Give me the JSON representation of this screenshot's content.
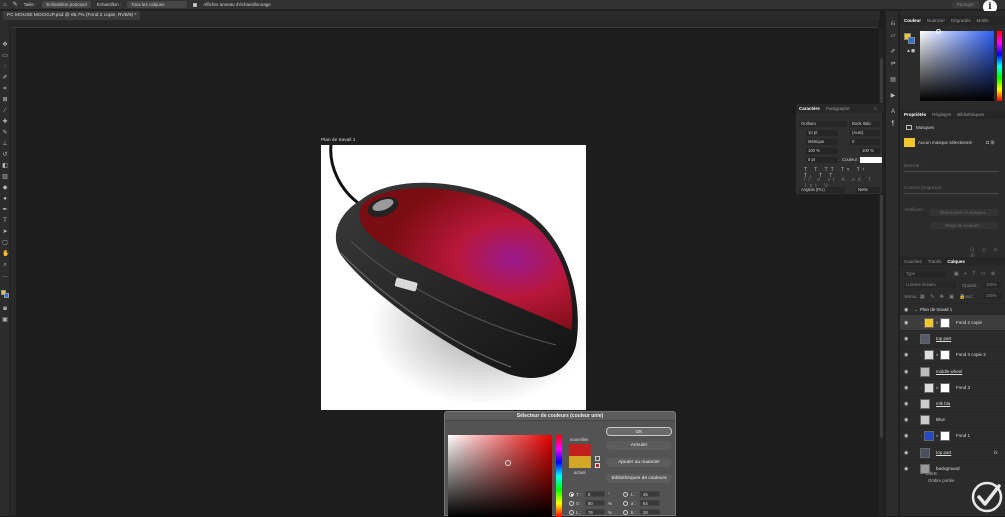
{
  "topbar": {
    "size_label": "Taille :",
    "size_value": "Echantillon ponctuel",
    "sample_label": "Echantillon :",
    "sample_value": "Tous les calques",
    "ring_label": "Afficher anneau d'échantillonnage",
    "share_label": "Partager"
  },
  "document": {
    "tab_title": "PC MOUSE MOCKUP.psd @ 66,7% (Fond 2 copie, RVB/8) *",
    "artboard_label": "Plan de travail 1"
  },
  "color_panel": {
    "tabs": [
      "Couleur",
      "Nuancier",
      "Dégradés",
      "Motifs"
    ],
    "fg_color": "#f2c72c",
    "bg_color": "#ffffff"
  },
  "properties_panel": {
    "tabs": [
      "Propriétés",
      "Réglages",
      "Bibliothèques"
    ],
    "section": "Masques",
    "no_mask": "Aucun masque sélectionné",
    "density_label": "Densité :",
    "feather_label": "Contour progressif :",
    "refine_label": "Améliorer :",
    "select_mask_btn": "Sélectionner et masquer...",
    "color_range_btn": "Plage de couleurs..."
  },
  "layers_panel": {
    "tabs": [
      "Couches",
      "Tracés",
      "Calques"
    ],
    "search_placeholder": "Type",
    "blend_mode": "Lumière linéaire",
    "opacity_label": "Opacité :",
    "opacity_value": "100%",
    "lock_label": "Verrou :",
    "fill_label": "Fond :",
    "fill_value": "100%",
    "group_name": "Plan de travail 1",
    "layers": [
      {
        "name": "Fond 2 copie",
        "selected": true,
        "thumb": "#f2c72c",
        "mask": true,
        "underline": false,
        "indent": true
      },
      {
        "name": "top part",
        "selected": false,
        "thumb": "#555a6a",
        "mask": false,
        "underline": true,
        "indent": false
      },
      {
        "name": "Fond 3 copie 2",
        "selected": false,
        "thumb": "#dddddd",
        "mask": true,
        "underline": false,
        "indent": true
      },
      {
        "name": "middle wheel",
        "selected": false,
        "thumb": "#bbbbbb",
        "mask": false,
        "underline": true,
        "indent": false
      },
      {
        "name": "Fond 3",
        "selected": false,
        "thumb": "#dddddd",
        "mask": true,
        "underline": false,
        "indent": true
      },
      {
        "name": "mlk bla",
        "selected": false,
        "thumb": "#cccccc",
        "mask": false,
        "underline": true,
        "indent": false
      },
      {
        "name": "Blue",
        "selected": false,
        "thumb": "#cccccc",
        "mask": false,
        "underline": false,
        "indent": false
      },
      {
        "name": "Fond 1",
        "selected": false,
        "thumb": "#2448c8",
        "mask": true,
        "underline": false,
        "indent": true
      },
      {
        "name": "top part",
        "selected": false,
        "thumb": "#4a4f60",
        "mask": false,
        "underline": true,
        "indent": false,
        "fx": "fx"
      },
      {
        "name": "background",
        "selected": false,
        "thumb": "#999999",
        "mask": false,
        "underline": false,
        "indent": false
      }
    ],
    "effects_label": "Effets",
    "drop_shadow_label": "Ombre portée"
  },
  "character_panel": {
    "tabs": [
      "Caractère",
      "Paragraphe"
    ],
    "font_family": "Gotham",
    "font_style": "Book Italic",
    "font_size": "10 pt",
    "leading": "(Auto)",
    "kerning": "Métrique",
    "tracking": "0",
    "vscale": "100 %",
    "hscale": "100 %",
    "baseline": "0 pt",
    "color_label": "Couleur :",
    "language": "Anglais (RU)",
    "aa": "Nette"
  },
  "color_dialog": {
    "title": "Sélecteur de couleurs (couleur unie)",
    "ok": "OK",
    "cancel": "Annuler",
    "add_swatch": "Ajouter au nuancier",
    "libraries": "Bibliothèques de couleurs",
    "new_label": "nouvelles",
    "current_label": "actuel",
    "new_color": "#c21f1f",
    "current_color": "#d4a62a",
    "fields": [
      {
        "label": "T :",
        "value": "0",
        "unit": "°",
        "checked": true
      },
      {
        "label": "S :",
        "value": "80",
        "unit": "%",
        "checked": false
      },
      {
        "label": "L :",
        "value": "76",
        "unit": "%",
        "checked": false
      }
    ],
    "lab_fields": [
      {
        "label": "L :",
        "value": "46"
      },
      {
        "label": "a :",
        "value": "64"
      },
      {
        "label": "b :",
        "value": "28"
      }
    ]
  }
}
